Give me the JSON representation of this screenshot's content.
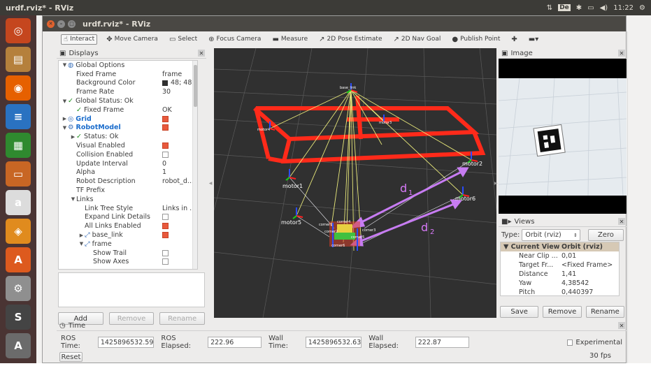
{
  "os": {
    "top_title": "urdf.rviz* - RViz",
    "clock": "11:22",
    "kb_layout": "De"
  },
  "launcher": [
    {
      "icon": "ubuntu-icon",
      "color": "#c5461e",
      "glyph": "◎"
    },
    {
      "icon": "files-icon",
      "color": "#b5803c",
      "glyph": "▤"
    },
    {
      "icon": "firefox-icon",
      "color": "#e66000",
      "glyph": "◉"
    },
    {
      "icon": "writer-icon",
      "color": "#2a72c1",
      "glyph": "≡"
    },
    {
      "icon": "calc-icon",
      "color": "#2f8a2f",
      "glyph": "▦"
    },
    {
      "icon": "impress-icon",
      "color": "#c86624",
      "glyph": "▭"
    },
    {
      "icon": "amazon-icon",
      "color": "#dcdcdc",
      "glyph": "a"
    },
    {
      "icon": "apps-icon",
      "color": "#e08b1e",
      "glyph": "◈"
    },
    {
      "icon": "software-center-icon",
      "color": "#dd5a1e",
      "glyph": "A"
    },
    {
      "icon": "settings-icon",
      "color": "#8f8f8f",
      "glyph": "⚙"
    },
    {
      "icon": "sublime-icon",
      "color": "#444",
      "glyph": "S"
    },
    {
      "icon": "updater-icon",
      "color": "#6b6b6b",
      "glyph": "A"
    }
  ],
  "window": {
    "title": "urdf.rviz* - RViz"
  },
  "toolbar": [
    {
      "label": "Interact",
      "icon": "hand-icon",
      "glyph": "☝",
      "active": true
    },
    {
      "label": "Move Camera",
      "icon": "move-camera-icon",
      "glyph": "✥"
    },
    {
      "label": "Select",
      "icon": "select-icon",
      "glyph": "▭"
    },
    {
      "label": "Focus Camera",
      "icon": "focus-icon",
      "glyph": "⊕"
    },
    {
      "label": "Measure",
      "icon": "measure-icon",
      "glyph": "▬"
    },
    {
      "label": "2D Pose Estimate",
      "icon": "pose-estimate-icon",
      "glyph": "↗"
    },
    {
      "label": "2D Nav Goal",
      "icon": "nav-goal-icon",
      "glyph": "↗"
    },
    {
      "label": "Publish Point",
      "icon": "publish-point-icon",
      "glyph": "●"
    },
    {
      "label": "",
      "icon": "plus-icon",
      "glyph": "✚"
    },
    {
      "label": "",
      "icon": "minus-icon",
      "glyph": "▬▾"
    }
  ],
  "displays": {
    "title": "Displays",
    "rows": [
      {
        "indent": 0,
        "arrow": "▼",
        "icon": "◍",
        "label": "Global Options",
        "value": "",
        "style": ""
      },
      {
        "indent": 1,
        "label": "Fixed Frame",
        "value": "frame"
      },
      {
        "indent": 1,
        "label": "Background Color",
        "value": "48; 48;",
        "swatch": true
      },
      {
        "indent": 1,
        "label": "Frame Rate",
        "value": "30"
      },
      {
        "indent": 0,
        "arrow": "▼",
        "check": true,
        "label": "Global Status: Ok",
        "value": ""
      },
      {
        "indent": 1,
        "check": true,
        "label": "Fixed Frame",
        "value": "OK"
      },
      {
        "indent": 0,
        "arrow": "▶",
        "icon": "◎",
        "label": "Grid",
        "value": "",
        "style": "blue",
        "cb": "on"
      },
      {
        "indent": 0,
        "arrow": "▼",
        "icon": "⚙",
        "label": "RobotModel",
        "value": "",
        "style": "blue",
        "cb": "on"
      },
      {
        "indent": 1,
        "arrow": "▶",
        "check": true,
        "label": "Status: Ok",
        "value": ""
      },
      {
        "indent": 1,
        "label": "Visual Enabled",
        "value": "",
        "cb": "on"
      },
      {
        "indent": 1,
        "label": "Collision Enabled",
        "value": "",
        "cb": "off"
      },
      {
        "indent": 1,
        "label": "Update Interval",
        "value": "0"
      },
      {
        "indent": 1,
        "label": "Alpha",
        "value": "1"
      },
      {
        "indent": 1,
        "label": "Robot Description",
        "value": "robot_d..."
      },
      {
        "indent": 1,
        "label": "TF Prefix",
        "value": ""
      },
      {
        "indent": 1,
        "arrow": "▼",
        "label": "Links",
        "value": ""
      },
      {
        "indent": 2,
        "label": "Link Tree Style",
        "value": "Links in ..."
      },
      {
        "indent": 2,
        "label": "Expand Link Details",
        "value": "",
        "cb": "off"
      },
      {
        "indent": 2,
        "label": "All Links Enabled",
        "value": "",
        "cb": "on"
      },
      {
        "indent": 2,
        "arrow": "▶",
        "icon": "⤢",
        "label": "base_link",
        "value": "",
        "cb": "on"
      },
      {
        "indent": 2,
        "arrow": "▼",
        "icon": "⤢",
        "label": "frame",
        "value": ""
      },
      {
        "indent": 3,
        "label": "Show Trail",
        "value": "",
        "cb": "off"
      },
      {
        "indent": 3,
        "label": "Show Axes",
        "value": "",
        "cb": "off"
      }
    ],
    "add": "Add",
    "remove": "Remove",
    "rename": "Rename"
  },
  "scene": {
    "labels": [
      "motor1",
      "motor5",
      "motor2",
      "motor6",
      "motor4",
      "motor3"
    ],
    "annotations": [
      "d",
      "1",
      "d",
      "2"
    ],
    "small_labels": [
      "base_link",
      "corner1",
      "corner2",
      "corner3",
      "corner4",
      "corner5",
      "corner6"
    ]
  },
  "image_panel": {
    "title": "Image"
  },
  "views": {
    "title": "Views",
    "type_label": "Type:",
    "type_value": "Orbit (rviz)",
    "zero": "Zero",
    "header": [
      "Current View",
      "Orbit (rviz)"
    ],
    "rows": [
      [
        "Near Clip ...",
        "0,01"
      ],
      [
        "Target Fr...",
        "<Fixed Frame>"
      ],
      [
        "Distance",
        "1,41"
      ],
      [
        "Yaw",
        "4,38542"
      ],
      [
        "Pitch",
        "0,440397"
      ]
    ],
    "save": "Save",
    "remove": "Remove",
    "rename": "Rename"
  },
  "time": {
    "title": "Time",
    "ros_time_label": "ROS Time:",
    "ros_time": "1425896532.59",
    "ros_elapsed_label": "ROS Elapsed:",
    "ros_elapsed": "222.96",
    "wall_time_label": "Wall Time:",
    "wall_time": "1425896532.63",
    "wall_elapsed_label": "Wall Elapsed:",
    "wall_elapsed": "222.87",
    "experimental": "Experimental",
    "reset": "Reset",
    "fps": "30 fps"
  }
}
